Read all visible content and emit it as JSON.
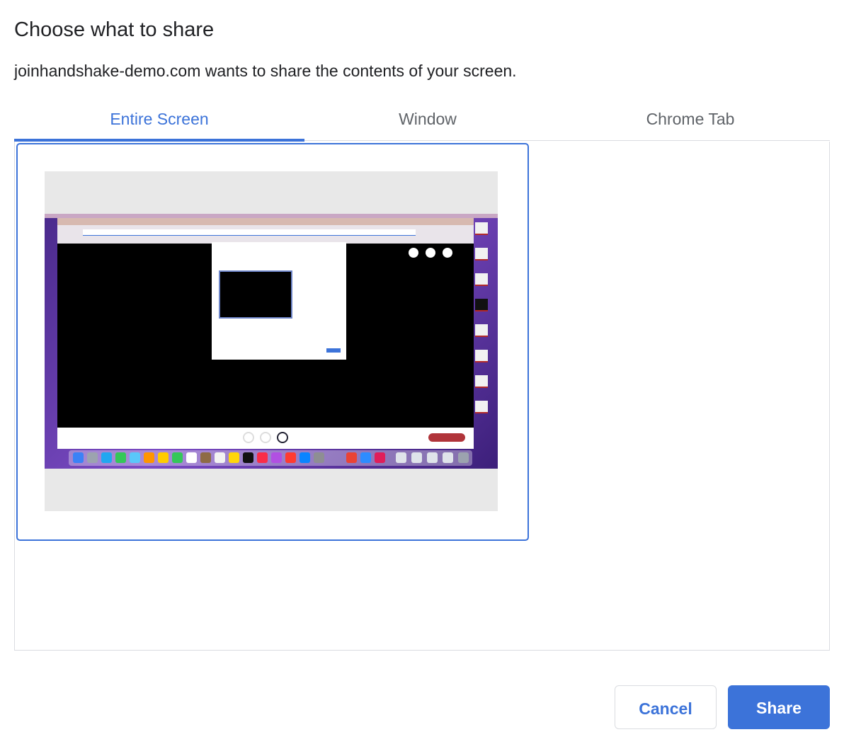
{
  "dialog": {
    "title": "Choose what to share",
    "subtitle": "joinhandshake-demo.com wants to share the contents of your screen."
  },
  "tabs": [
    {
      "label": "Entire Screen",
      "active": true
    },
    {
      "label": "Window",
      "active": false
    },
    {
      "label": "Chrome Tab",
      "active": false
    }
  ],
  "source": {
    "thumbnail_icon": "screen-thumbnail",
    "selected": true
  },
  "buttons": {
    "cancel_label": "Cancel",
    "share_label": "Share"
  },
  "colors": {
    "accent": "#3c73d9",
    "border": "#dadce0",
    "text": "#202124",
    "muted_text": "#5f6368"
  }
}
